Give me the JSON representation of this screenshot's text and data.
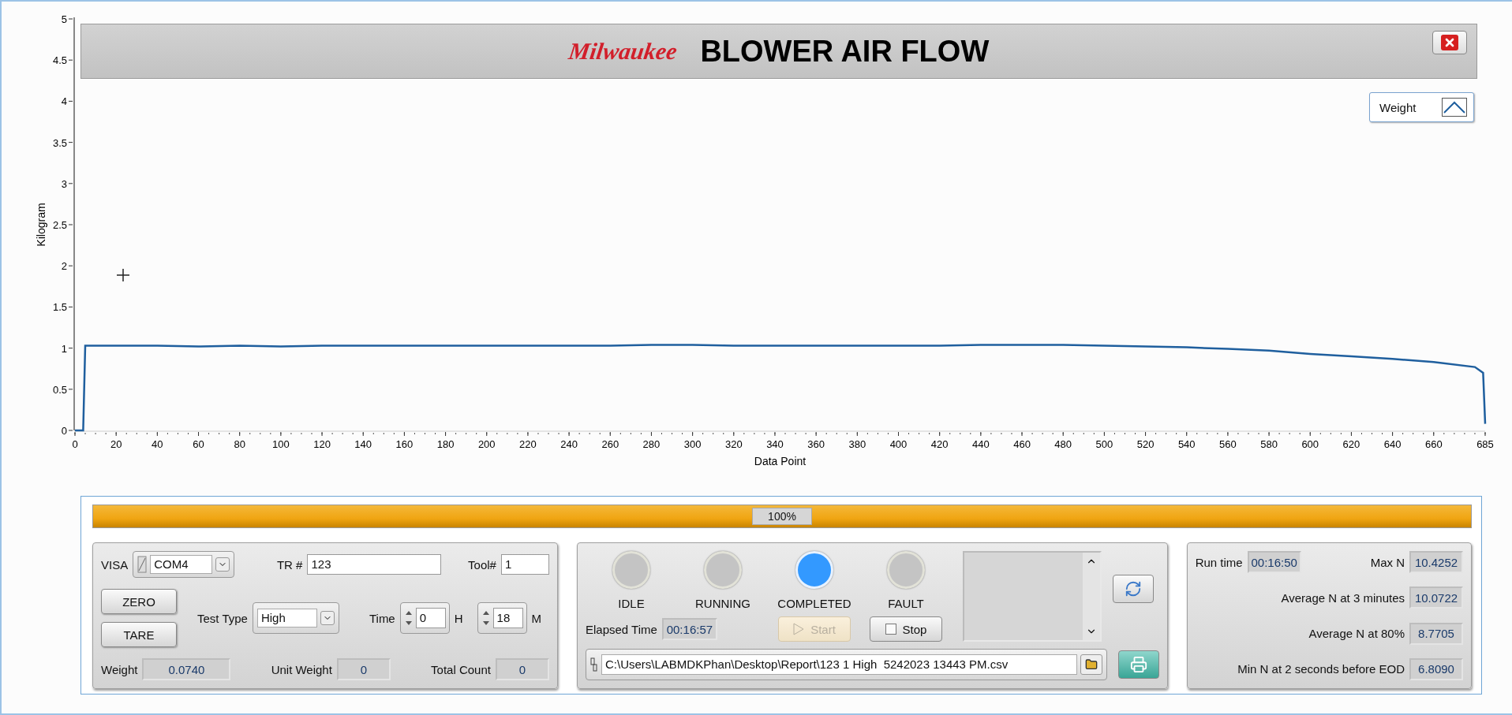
{
  "header": {
    "logo": "Milwaukee",
    "title": "BLOWER AIR FLOW"
  },
  "graph": {
    "chart_data": {
      "type": "line",
      "xlabel": "Data Point",
      "ylabel": "Kilogram",
      "x": [
        0,
        4,
        5,
        20,
        40,
        60,
        80,
        100,
        120,
        140,
        160,
        180,
        200,
        220,
        240,
        260,
        280,
        300,
        320,
        340,
        360,
        380,
        400,
        420,
        440,
        460,
        480,
        500,
        520,
        540,
        560,
        580,
        600,
        620,
        640,
        660,
        680,
        684,
        685
      ],
      "series": [
        {
          "name": "Weight",
          "color": "#1f5f9e",
          "values": [
            0,
            0,
            1.03,
            1.03,
            1.03,
            1.02,
            1.03,
            1.02,
            1.03,
            1.03,
            1.03,
            1.03,
            1.03,
            1.03,
            1.03,
            1.03,
            1.04,
            1.04,
            1.03,
            1.03,
            1.03,
            1.03,
            1.03,
            1.03,
            1.04,
            1.04,
            1.04,
            1.03,
            1.02,
            1.01,
            0.99,
            0.97,
            0.93,
            0.9,
            0.87,
            0.83,
            0.77,
            0.7,
            0.08
          ]
        }
      ],
      "xlim": [
        0,
        685
      ],
      "ylim": [
        0,
        5
      ],
      "xticks": [
        0,
        20,
        40,
        60,
        80,
        100,
        120,
        140,
        160,
        180,
        200,
        220,
        240,
        260,
        280,
        300,
        320,
        340,
        360,
        380,
        400,
        420,
        440,
        460,
        480,
        500,
        520,
        540,
        560,
        580,
        600,
        620,
        640,
        660,
        685
      ],
      "yticks": [
        0,
        0.5,
        1,
        1.5,
        2,
        2.5,
        3,
        3.5,
        4,
        4.5,
        5
      ]
    }
  },
  "progress": {
    "level": 1,
    "label": "100%"
  },
  "setup": {
    "visa": {
      "label": "VISA",
      "value": "COM4"
    },
    "tr": {
      "label": "TR #",
      "value": "123"
    },
    "tool": {
      "label": "Tool#",
      "value": "1"
    },
    "buttons": [
      "ZERO",
      "TARE"
    ],
    "test_type": {
      "label": "Test Type",
      "value": "High"
    },
    "time": {
      "label": "Time",
      "hours": "0",
      "hours_unit": "H",
      "minutes": "18",
      "minutes_unit": "M"
    },
    "readouts": [
      {
        "label": "Weight",
        "value": "0.0740"
      },
      {
        "label": "Unit Weight",
        "value": "0"
      },
      {
        "label": "Total Count",
        "value": "0"
      }
    ]
  },
  "status": {
    "lamps": [
      {
        "label": "IDLE",
        "on": false
      },
      {
        "label": "RUNNING",
        "on": false
      },
      {
        "label": "COMPLETED",
        "on": true
      },
      {
        "label": "FAULT",
        "on": false
      }
    ],
    "elapsed": {
      "label": "Elapsed Time",
      "value": "00:16:57"
    },
    "start": {
      "label": "Start",
      "disabled": true
    },
    "stop": {
      "label": "Stop",
      "checked": false
    },
    "path": "C:\\Users\\LABMDKPhan\\Desktop\\Report\\123 1 High  5242023 13443 PM.csv"
  },
  "results": {
    "run_time": {
      "label": "Run time",
      "value": "00:16:50"
    },
    "rows": [
      {
        "label": "Max N",
        "value": "10.4252"
      },
      {
        "label": "Average N at 3 minutes",
        "value": "10.0722"
      },
      {
        "label": "Average N at 80%",
        "value": "8.7705"
      },
      {
        "label": "Min N at 2 seconds before EOD",
        "value": "6.8090"
      }
    ]
  }
}
